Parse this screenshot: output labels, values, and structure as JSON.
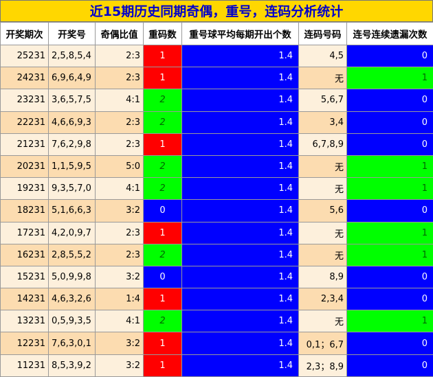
{
  "title": "近15期历史同期奇偶，重号，连码分析统计",
  "headers": [
    "开奖期次",
    "开奖号",
    "奇偶比值",
    "重码数",
    "重号球平均每期开出个数",
    "连码号码",
    "连号连续遗漏次数"
  ],
  "colors": {
    "title_bg": "#ffd700",
    "title_fg": "#0000cc",
    "red": "#ff0000",
    "green": "#00ff00",
    "blue": "#0000ff",
    "row_light": "#fdf0dc",
    "row_dark": "#fcdcb0"
  },
  "rows": [
    {
      "period": "25231",
      "nums": "2,5,8,5,4",
      "ratio": "2:3",
      "rep": "1",
      "rep_color": "red",
      "avg": "1.4",
      "conn": "4,5",
      "miss": "0",
      "miss_color": "blue"
    },
    {
      "period": "24231",
      "nums": "6,9,6,4,9",
      "ratio": "2:3",
      "rep": "1",
      "rep_color": "red",
      "avg": "1.4",
      "conn": "无",
      "miss": "1",
      "miss_color": "green"
    },
    {
      "period": "23231",
      "nums": "3,6,5,7,5",
      "ratio": "4:1",
      "rep": "2",
      "rep_color": "green",
      "avg": "1.4",
      "conn": "5,6,7",
      "miss": "0",
      "miss_color": "blue"
    },
    {
      "period": "22231",
      "nums": "4,6,6,9,3",
      "ratio": "2:3",
      "rep": "2",
      "rep_color": "green",
      "avg": "1.4",
      "conn": "3,4",
      "miss": "0",
      "miss_color": "blue"
    },
    {
      "period": "21231",
      "nums": "7,6,2,9,8",
      "ratio": "2:3",
      "rep": "1",
      "rep_color": "red",
      "avg": "1.4",
      "conn": "6,7,8,9",
      "miss": "0",
      "miss_color": "blue"
    },
    {
      "period": "20231",
      "nums": "1,1,5,9,5",
      "ratio": "5:0",
      "rep": "2",
      "rep_color": "green",
      "avg": "1.4",
      "conn": "无",
      "miss": "1",
      "miss_color": "green"
    },
    {
      "period": "19231",
      "nums": "9,3,5,7,0",
      "ratio": "4:1",
      "rep": "2",
      "rep_color": "green",
      "avg": "1.4",
      "conn": "无",
      "miss": "1",
      "miss_color": "green"
    },
    {
      "period": "18231",
      "nums": "5,1,6,6,3",
      "ratio": "3:2",
      "rep": "0",
      "rep_color": "blue",
      "avg": "1.4",
      "conn": "5,6",
      "miss": "0",
      "miss_color": "blue"
    },
    {
      "period": "17231",
      "nums": "4,2,0,9,7",
      "ratio": "2:3",
      "rep": "1",
      "rep_color": "red",
      "avg": "1.4",
      "conn": "无",
      "miss": "1",
      "miss_color": "green"
    },
    {
      "period": "16231",
      "nums": "2,8,5,5,2",
      "ratio": "2:3",
      "rep": "2",
      "rep_color": "green",
      "avg": "1.4",
      "conn": "无",
      "miss": "1",
      "miss_color": "green"
    },
    {
      "period": "15231",
      "nums": "5,0,9,9,8",
      "ratio": "3:2",
      "rep": "0",
      "rep_color": "blue",
      "avg": "1.4",
      "conn": "8,9",
      "miss": "0",
      "miss_color": "blue"
    },
    {
      "period": "14231",
      "nums": "4,6,3,2,6",
      "ratio": "1:4",
      "rep": "1",
      "rep_color": "red",
      "avg": "1.4",
      "conn": "2,3,4",
      "miss": "0",
      "miss_color": "blue"
    },
    {
      "period": "13231",
      "nums": "0,5,9,3,5",
      "ratio": "4:1",
      "rep": "2",
      "rep_color": "green",
      "avg": "1.4",
      "conn": "无",
      "miss": "1",
      "miss_color": "green"
    },
    {
      "period": "12231",
      "nums": "7,6,3,0,1",
      "ratio": "3:2",
      "rep": "1",
      "rep_color": "red",
      "avg": "1.4",
      "conn": "0,1；6,7",
      "miss": "0",
      "miss_color": "blue"
    },
    {
      "period": "11231",
      "nums": "8,5,3,9,2",
      "ratio": "3:2",
      "rep": "1",
      "rep_color": "red",
      "avg": "1.4",
      "conn": "2,3；8,9",
      "miss": "0",
      "miss_color": "blue"
    }
  ]
}
